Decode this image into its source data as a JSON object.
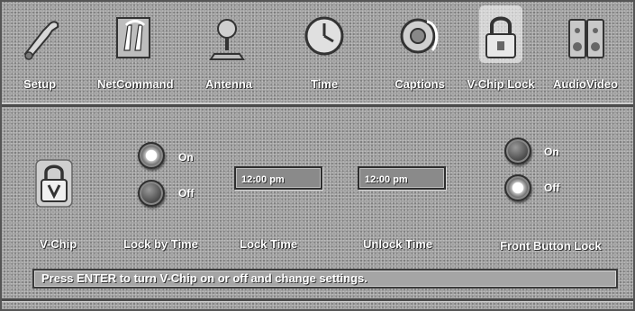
{
  "menu": {
    "items": [
      {
        "label": "Setup",
        "icon": "wrench-icon"
      },
      {
        "label": "NetCommand",
        "icon": "netcommand-icon"
      },
      {
        "label": "Antenna",
        "icon": "antenna-icon"
      },
      {
        "label": "Time",
        "icon": "clock-icon"
      },
      {
        "label": "Captions",
        "icon": "captions-icon"
      },
      {
        "label": "V-Chip Lock",
        "icon": "padlock-icon",
        "active": true
      },
      {
        "label": "AudioVideo",
        "icon": "speaker-icon"
      }
    ]
  },
  "vchip": {
    "label": "V-Chip",
    "icon": "padlock-v-icon"
  },
  "lock_by_time": {
    "label": "Lock by Time",
    "on_label": "On",
    "off_label": "Off",
    "selected": "On"
  },
  "lock_time": {
    "label": "Lock Time",
    "value": "12:00 pm"
  },
  "unlock_time": {
    "label": "Unlock Time",
    "value": "12:00 pm"
  },
  "front_button_lock": {
    "label": "Front Button Lock",
    "on_label": "On",
    "off_label": "Off",
    "selected": "Off"
  },
  "status": {
    "text": "Press ENTER to turn V-Chip on or off and change settings."
  },
  "colors": {
    "background": "#9a9a9a",
    "text": "#ffffff",
    "border": "#3c3c3c"
  }
}
